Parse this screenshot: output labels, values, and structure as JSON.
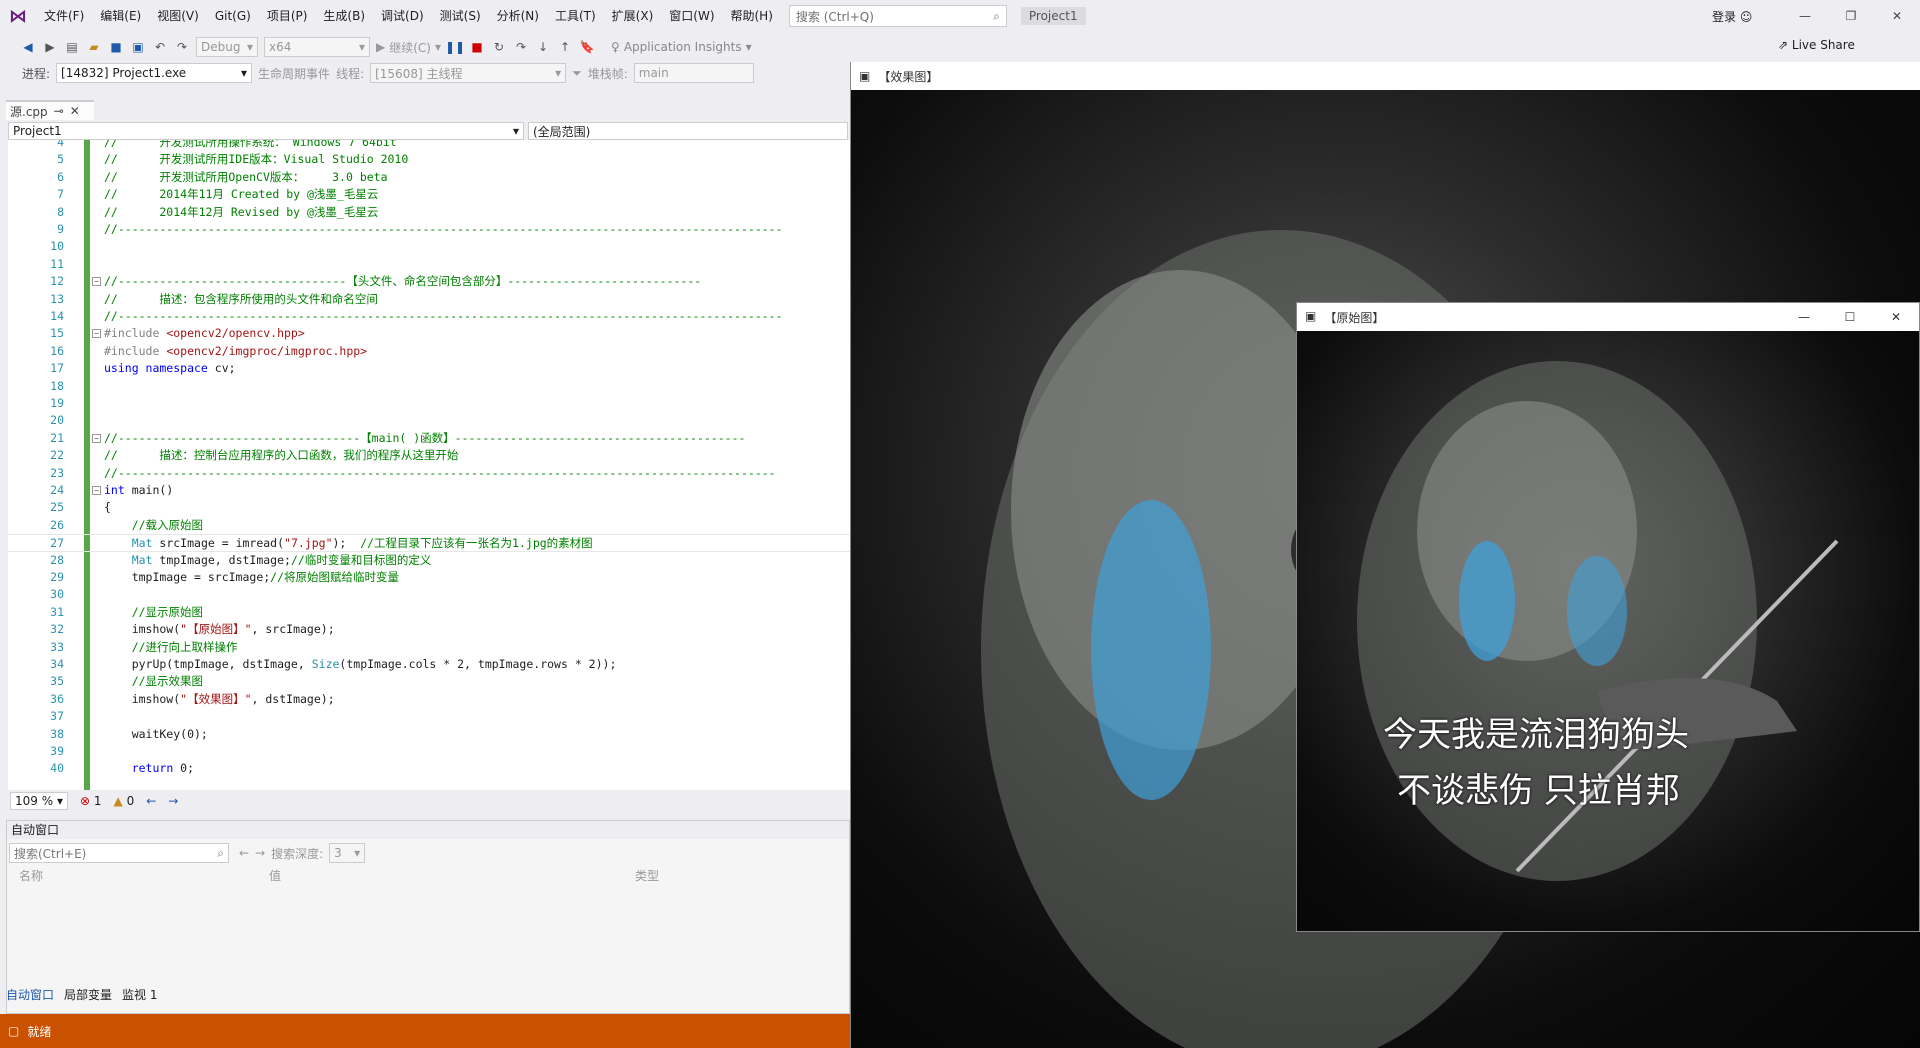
{
  "menubar": {
    "items": [
      "文件(F)",
      "编辑(E)",
      "视图(V)",
      "Git(G)",
      "项目(P)",
      "生成(B)",
      "调试(D)",
      "测试(S)",
      "分析(N)",
      "工具(T)",
      "扩展(X)",
      "窗口(W)",
      "帮助(H)"
    ],
    "search_placeholder": "搜索 (Ctrl+Q)",
    "project_title": "Project1",
    "login": "登录"
  },
  "toolbar": {
    "config": "Debug",
    "platform": "x64",
    "continue": "继续(C)",
    "app_insights": "Application Insights",
    "live_share": "Live Share"
  },
  "debugbar": {
    "process_label": "进程:",
    "process_value": "[14832] Project1.exe",
    "lifecycle": "生命周期事件",
    "thread_label": "线程:",
    "thread_value": "[15608] 主线程",
    "stackframe_label": "堆栈帧:",
    "stackframe_value": "main"
  },
  "editor": {
    "tab_label": "源.cpp",
    "nav_project": "Project1",
    "nav_scope": "(全局范围)",
    "zoom": "109 %",
    "errors": "1",
    "warnings": "0",
    "lines": [
      {
        "n": "4",
        "segs": [
          [
            "cmt",
            "//      开发测试所用操作系统： Windows 7 64bit"
          ]
        ]
      },
      {
        "n": "5",
        "segs": [
          [
            "cmt",
            "//      开发测试所用IDE版本：Visual Studio 2010"
          ]
        ]
      },
      {
        "n": "6",
        "segs": [
          [
            "cmt",
            "//      开发测试所用OpenCV版本：    3.0 beta"
          ]
        ]
      },
      {
        "n": "7",
        "segs": [
          [
            "cmt",
            "//      2014年11月 Created by @浅墨_毛星云"
          ]
        ]
      },
      {
        "n": "8",
        "segs": [
          [
            "cmt",
            "//      2014年12月 Revised by @浅墨_毛星云"
          ]
        ]
      },
      {
        "n": "9",
        "segs": [
          [
            "cmt",
            "//------------------------------------------------------------------------------------------------"
          ]
        ]
      },
      {
        "n": "10",
        "segs": []
      },
      {
        "n": "11",
        "segs": []
      },
      {
        "n": "12",
        "segs": [
          [
            "cmt",
            "//---------------------------------【头文件、命名空间包含部分】----------------------------"
          ]
        ]
      },
      {
        "n": "13",
        "segs": [
          [
            "cmt",
            "//      描述：包含程序所使用的头文件和命名空间"
          ]
        ]
      },
      {
        "n": "14",
        "segs": [
          [
            "cmt",
            "//------------------------------------------------------------------------------------------------"
          ]
        ]
      },
      {
        "n": "15",
        "segs": [
          [
            "pp",
            "#include "
          ],
          [
            "str",
            "<opencv2/opencv.hpp>"
          ]
        ]
      },
      {
        "n": "16",
        "segs": [
          [
            "pp",
            "#include "
          ],
          [
            "str",
            "<opencv2/imgproc/imgproc.hpp>"
          ]
        ]
      },
      {
        "n": "17",
        "segs": [
          [
            "kw",
            "using namespace "
          ],
          [
            "",
            "cv;"
          ]
        ]
      },
      {
        "n": "18",
        "segs": []
      },
      {
        "n": "19",
        "segs": []
      },
      {
        "n": "20",
        "segs": []
      },
      {
        "n": "21",
        "segs": [
          [
            "cmt",
            "//-----------------------------------【main( )函数】------------------------------------------"
          ]
        ]
      },
      {
        "n": "22",
        "segs": [
          [
            "cmt",
            "//      描述：控制台应用程序的入口函数，我们的程序从这里开始"
          ]
        ]
      },
      {
        "n": "23",
        "segs": [
          [
            "cmt",
            "//-----------------------------------------------------------------------------------------------"
          ]
        ]
      },
      {
        "n": "24",
        "segs": [
          [
            "kw",
            "int "
          ],
          [
            "",
            "main()"
          ]
        ]
      },
      {
        "n": "25",
        "segs": [
          [
            "",
            "{"
          ]
        ]
      },
      {
        "n": "26",
        "segs": [
          [
            "",
            "    "
          ],
          [
            "cmt",
            "//载入原始图"
          ]
        ]
      },
      {
        "n": "27",
        "segs": [
          [
            "",
            "    "
          ],
          [
            "ty",
            "Mat "
          ],
          [
            "",
            "srcImage = imread("
          ],
          [
            "str",
            "\"7.jpg\""
          ],
          [
            "",
            ");  "
          ],
          [
            "cmt",
            "//工程目录下应该有一张名为1.jpg的素材图"
          ]
        ]
      },
      {
        "n": "28",
        "segs": [
          [
            "",
            "    "
          ],
          [
            "ty",
            "Mat "
          ],
          [
            "",
            "tmpImage, dstImage;"
          ],
          [
            "cmt",
            "//临时变量和目标图的定义"
          ]
        ]
      },
      {
        "n": "29",
        "segs": [
          [
            "",
            "    tmpImage = srcImage;"
          ],
          [
            "cmt",
            "//将原始图赋给临时变量"
          ]
        ]
      },
      {
        "n": "30",
        "segs": []
      },
      {
        "n": "31",
        "segs": [
          [
            "",
            "    "
          ],
          [
            "cmt",
            "//显示原始图"
          ]
        ]
      },
      {
        "n": "32",
        "segs": [
          [
            "",
            "    imshow("
          ],
          [
            "str",
            "\"【原始图】\""
          ],
          [
            "",
            ", srcImage);"
          ]
        ]
      },
      {
        "n": "33",
        "segs": [
          [
            "",
            "    "
          ],
          [
            "cmt",
            "//进行向上取样操作"
          ]
        ]
      },
      {
        "n": "34",
        "segs": [
          [
            "",
            "    pyrUp(tmpImage, dstImage, "
          ],
          [
            "ty",
            "Size"
          ],
          [
            "",
            "(tmpImage.cols * 2, tmpImage.rows * 2));"
          ]
        ]
      },
      {
        "n": "35",
        "segs": [
          [
            "",
            "    "
          ],
          [
            "cmt",
            "//显示效果图"
          ]
        ]
      },
      {
        "n": "36",
        "segs": [
          [
            "",
            "    imshow("
          ],
          [
            "str",
            "\"【效果图】\""
          ],
          [
            "",
            ", dstImage);"
          ]
        ]
      },
      {
        "n": "37",
        "segs": []
      },
      {
        "n": "38",
        "segs": [
          [
            "",
            "    waitKey(0);"
          ]
        ]
      },
      {
        "n": "39",
        "segs": []
      },
      {
        "n": "40",
        "segs": [
          [
            "",
            "    "
          ],
          [
            "kw",
            "return "
          ],
          [
            "",
            "0;"
          ]
        ]
      }
    ]
  },
  "autowin": {
    "title": "自动窗口",
    "search_placeholder": "搜索(Ctrl+E)",
    "depth_label": "搜索深度:",
    "depth_value": "3",
    "col_name": "名称",
    "col_value": "值",
    "col_type": "类型",
    "tabs": [
      "自动窗口",
      "局部变量",
      "监视 1"
    ]
  },
  "status": {
    "ready": "就绪"
  },
  "effect_window": {
    "title": "【效果图】"
  },
  "orig_window": {
    "title": "【原始图】",
    "subtitle_line1": "今天我是流泪狗狗头",
    "subtitle_line2": "不谈悲伤 只拉肖邦"
  },
  "colors": {
    "status_bar": "#ca5100",
    "comment": "#008000",
    "keyword": "#0000ff",
    "string": "#a31515"
  }
}
